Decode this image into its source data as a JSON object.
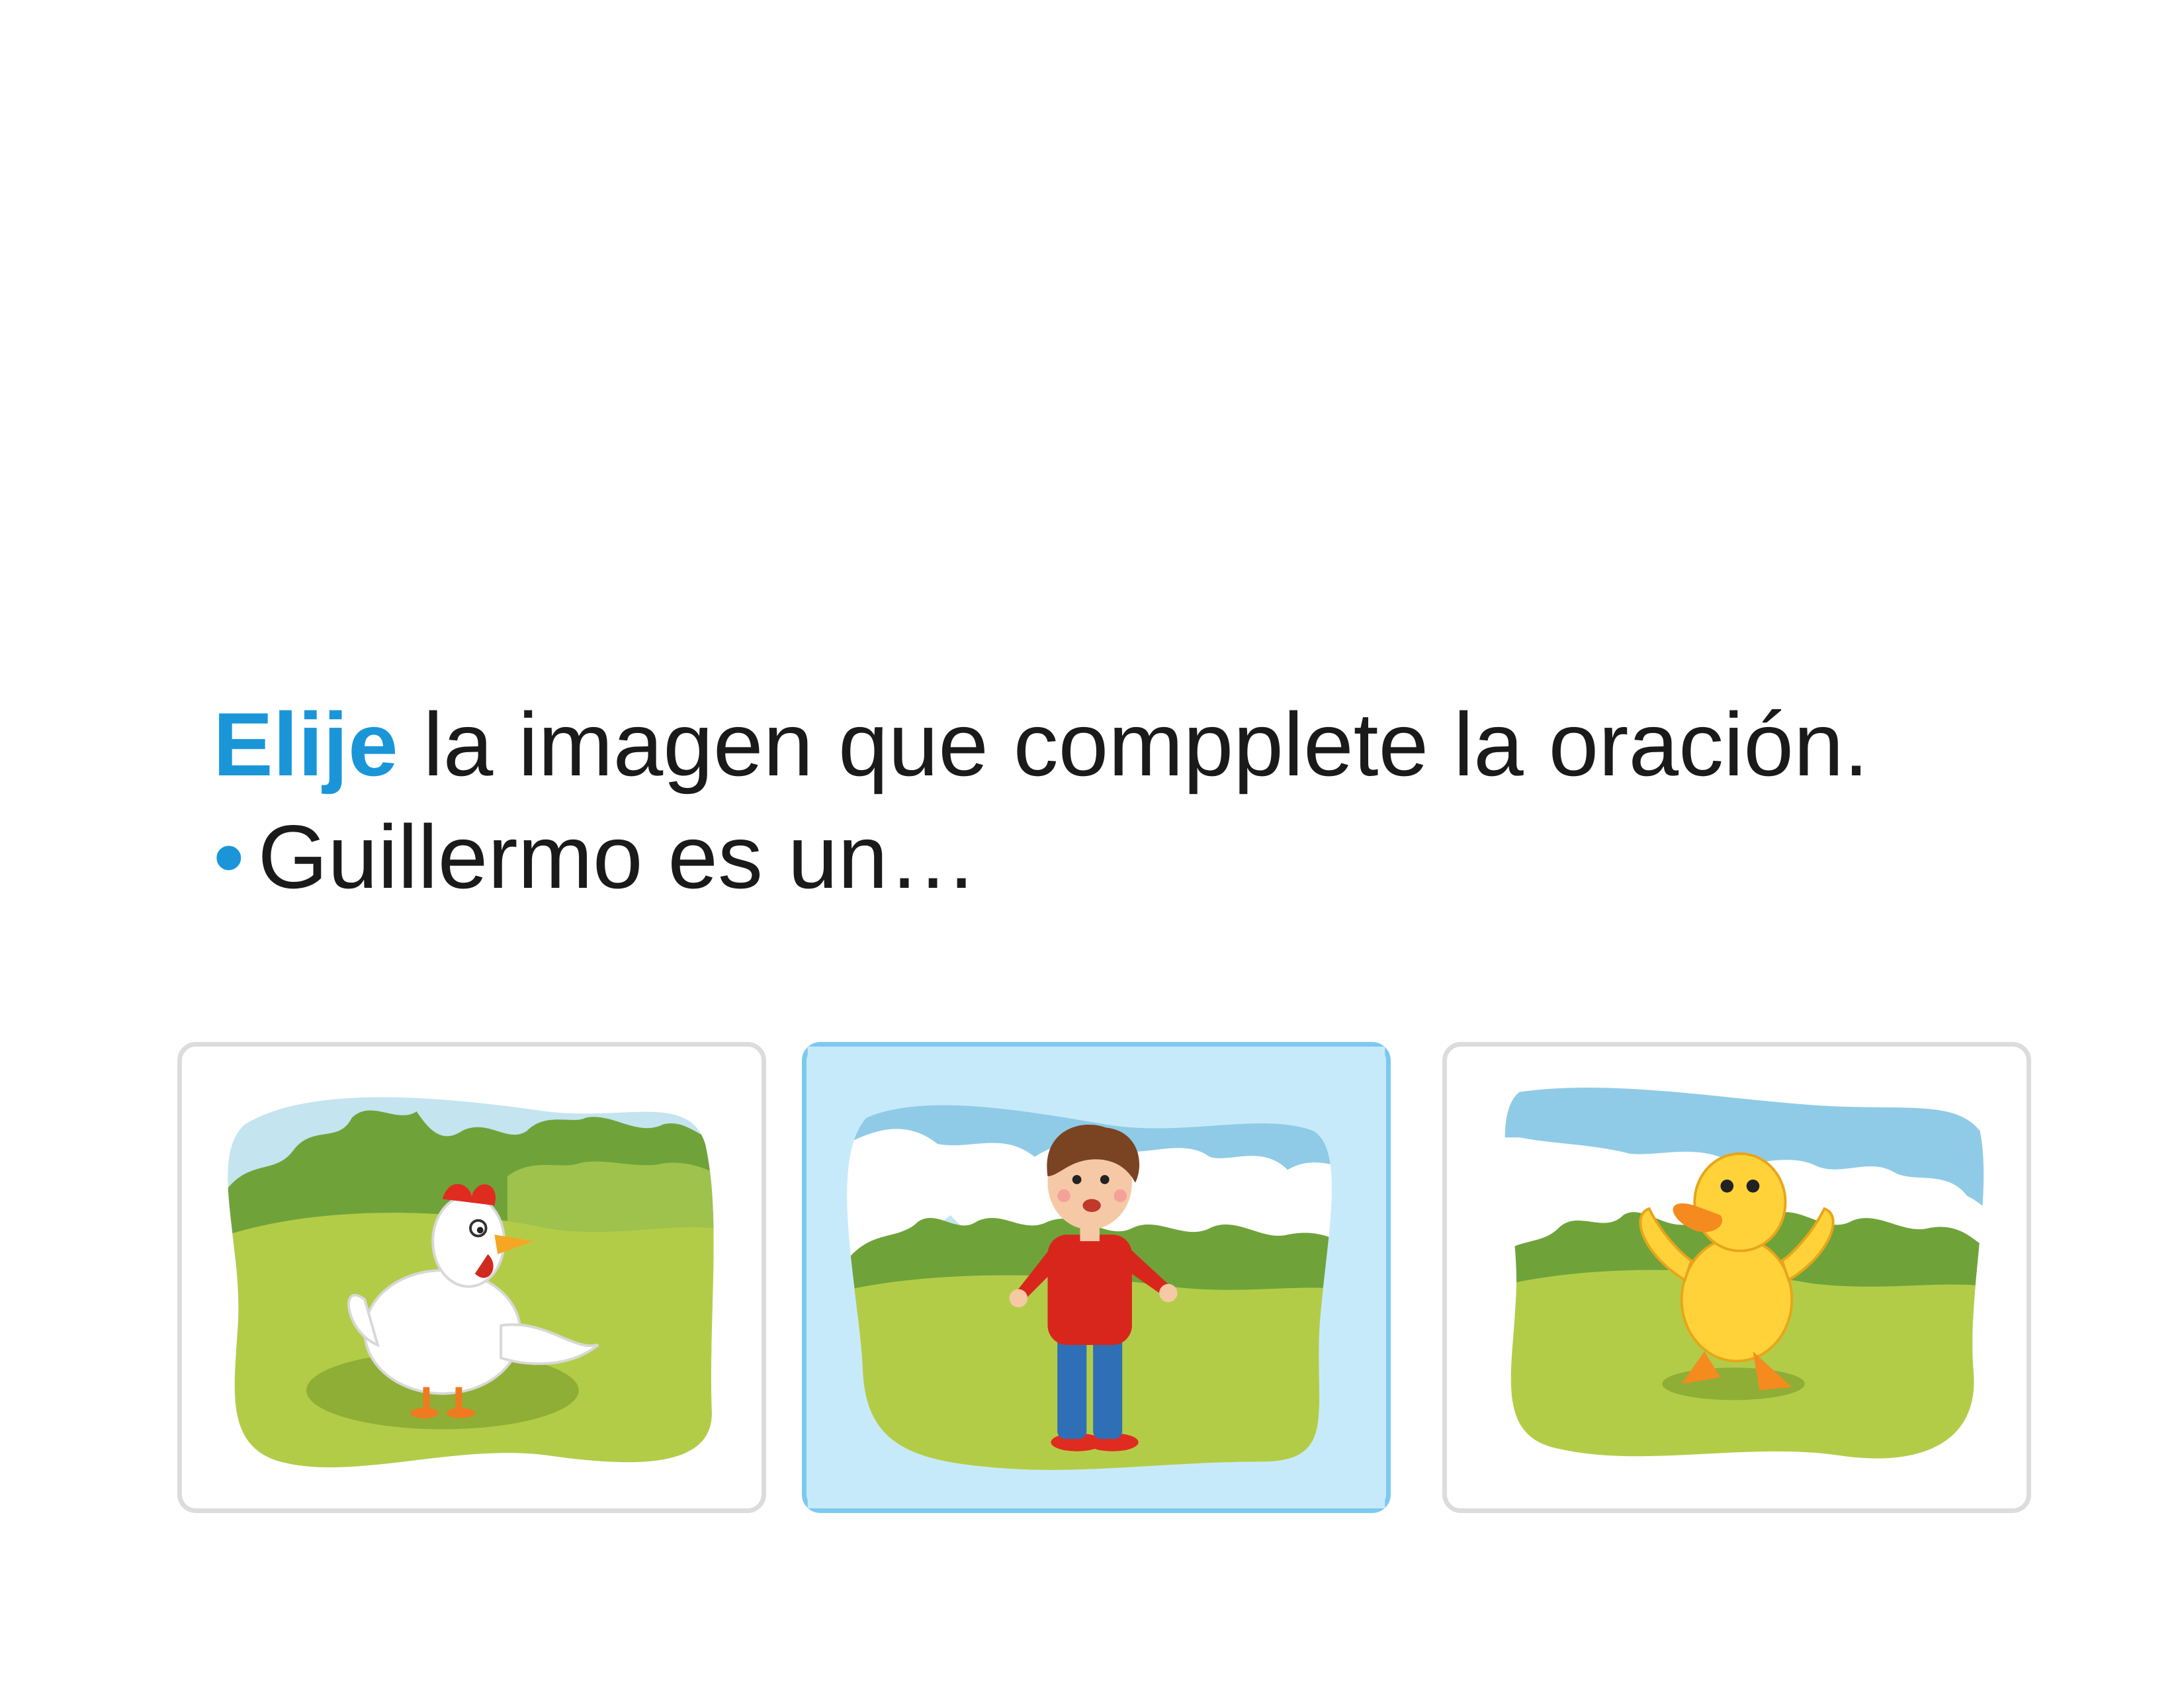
{
  "instruction": {
    "verb": "Elije",
    "rest": " la imagen que compplete la oración."
  },
  "prompt": {
    "bullet": "•",
    "text": "Guillermo es un…"
  },
  "options": [
    {
      "icon": "hen-icon",
      "selected": false
    },
    {
      "icon": "boy-icon",
      "selected": true
    },
    {
      "icon": "duckling-icon",
      "selected": false
    }
  ],
  "colors": {
    "accent": "#1a96d8",
    "selected_bg": "#c7eafb",
    "selected_border": "#7cc9ef",
    "card_border": "#dcdcdc",
    "grass": "#b3cc48",
    "bush": "#6fa33a",
    "sky": "#8fcbe6"
  }
}
